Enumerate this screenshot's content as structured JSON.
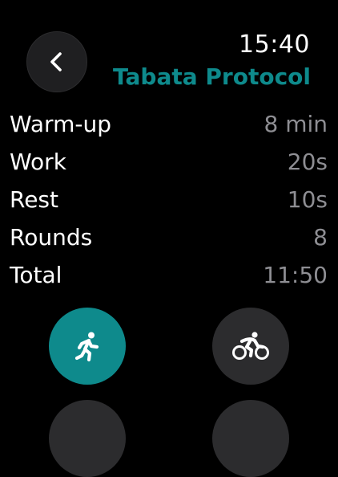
{
  "header": {
    "time": "15:40",
    "title": "Tabata Protocol",
    "back_icon": "chevron-left-icon"
  },
  "stats": [
    {
      "label": "Warm-up",
      "value": "8 min"
    },
    {
      "label": "Work",
      "value": "20s"
    },
    {
      "label": "Rest",
      "value": "10s"
    },
    {
      "label": "Rounds",
      "value": "8"
    },
    {
      "label": "Total",
      "value": "11:50"
    }
  ],
  "activities": [
    {
      "name": "running",
      "icon": "running-figure-icon",
      "selected": true
    },
    {
      "name": "cycling",
      "icon": "cyclist-icon",
      "selected": false
    }
  ],
  "colors": {
    "accent": "#0e8a8c",
    "background": "#000000",
    "button_dark": "#2c2c2e",
    "secondary_text": "#8e8e93"
  }
}
